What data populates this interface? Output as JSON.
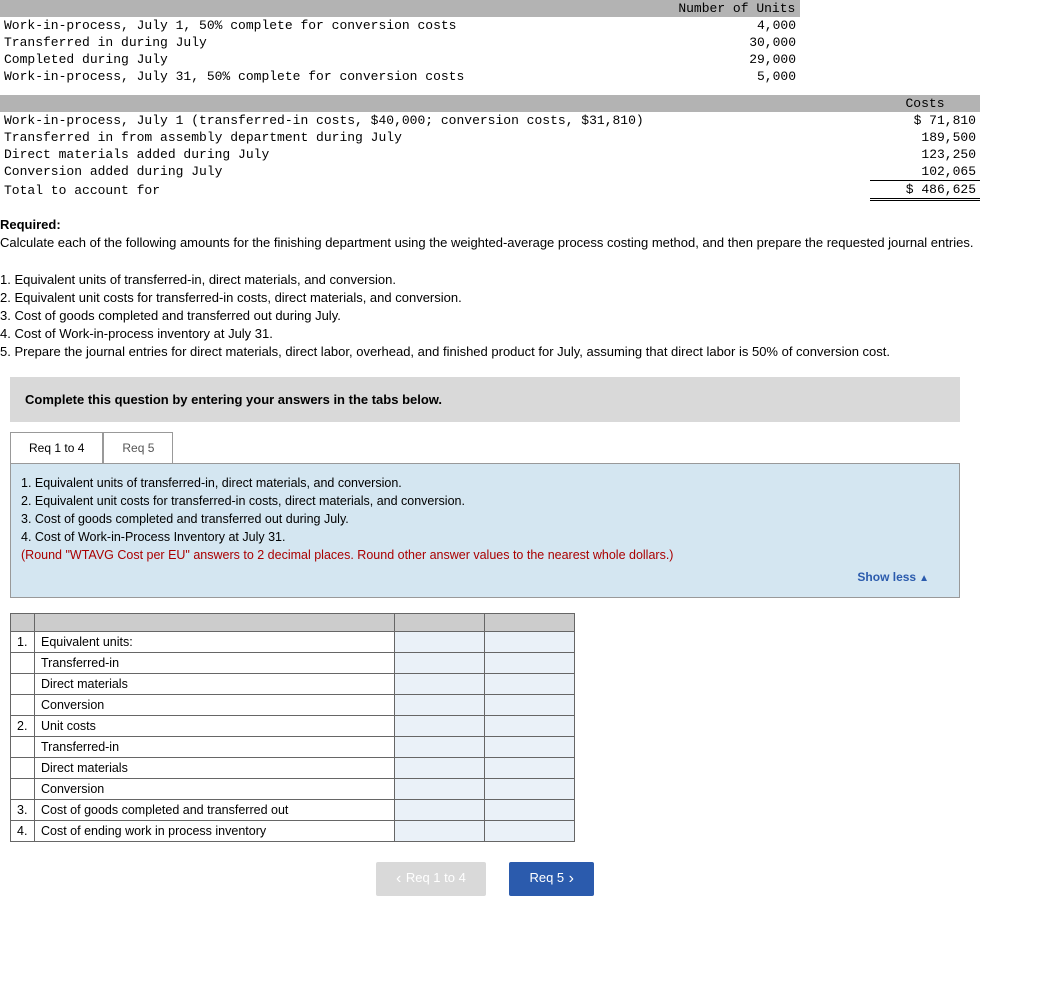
{
  "units_table": {
    "header": "Number of Units",
    "rows": [
      {
        "label": "Work-in-process, July 1, 50% complete for conversion costs",
        "val": "4,000"
      },
      {
        "label": "Transferred in during July",
        "val": "30,000"
      },
      {
        "label": "Completed during July",
        "val": "29,000"
      },
      {
        "label": "Work-in-process, July 31, 50% complete for conversion costs",
        "val": "5,000"
      }
    ]
  },
  "costs_table": {
    "header": "Costs",
    "rows": [
      {
        "label": "Work-in-process, July 1 (transferred-in costs, $40,000; conversion costs, $31,810)",
        "val": "$ 71,810"
      },
      {
        "label": "Transferred in from assembly department during July",
        "val": "189,500"
      },
      {
        "label": "Direct materials added during July",
        "val": "123,250"
      },
      {
        "label": "Conversion added during July",
        "val": "102,065"
      }
    ],
    "total_label": "Total to account for",
    "total_val": "$ 486,625"
  },
  "required": {
    "heading": "Required:",
    "intro": "Calculate each of the following amounts for the finishing department using the weighted-average process costing method, and then prepare the requested journal entries.",
    "items": [
      "1. Equivalent units of transferred-in, direct materials, and conversion.",
      "2. Equivalent unit costs for transferred-in costs, direct materials, and conversion.",
      "3. Cost of goods completed and transferred out during July.",
      "4. Cost of Work-in-process inventory at July 31.",
      "5. Prepare the journal entries for direct materials, direct labor, overhead, and finished product for July, assuming that direct labor is 50% of conversion cost."
    ]
  },
  "graybox": "Complete this question by entering your answers in the tabs below.",
  "tabs": {
    "t1": "Req 1 to 4",
    "t2": "Req 5"
  },
  "bluebox": {
    "l1": "1. Equivalent units of transferred-in, direct materials, and conversion.",
    "l2": "2. Equivalent unit costs for transferred-in costs, direct materials, and conversion.",
    "l3": "3. Cost of goods completed and transferred out during July.",
    "l4": "4. Cost of Work-in-Process Inventory at July 31.",
    "note": "(Round \"WTAVG Cost per EU\" answers to 2 decimal places. Round other answer values to the nearest whole dollars.)",
    "showless": "Show less"
  },
  "answers": {
    "r1": {
      "n": "1.",
      "l": "Equivalent units:"
    },
    "r2": {
      "n": "",
      "l": "Transferred-in"
    },
    "r3": {
      "n": "",
      "l": "Direct materials"
    },
    "r4": {
      "n": "",
      "l": "Conversion"
    },
    "r5": {
      "n": "2.",
      "l": "Unit costs"
    },
    "r6": {
      "n": "",
      "l": "Transferred-in"
    },
    "r7": {
      "n": "",
      "l": "Direct materials"
    },
    "r8": {
      "n": "",
      "l": "Conversion"
    },
    "r9": {
      "n": "3.",
      "l": "Cost of goods completed and transferred out"
    },
    "r10": {
      "n": "4.",
      "l": "Cost of ending work in process inventory"
    }
  },
  "nav": {
    "prev": "Req 1 to 4",
    "next": "Req 5"
  }
}
